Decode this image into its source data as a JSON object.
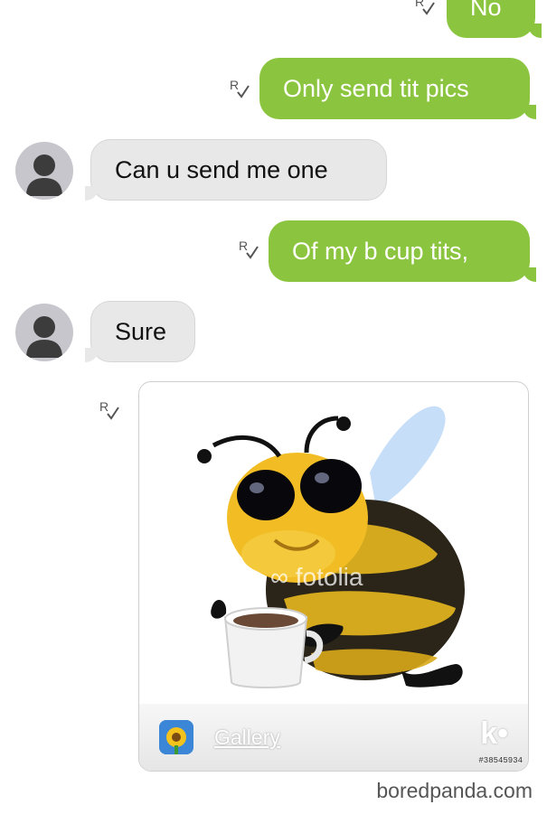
{
  "messages": [
    {
      "from": "me",
      "text": "No",
      "receipt": "R"
    },
    {
      "from": "me",
      "text": "Only send tit pics",
      "receipt": "R"
    },
    {
      "from": "them",
      "text": "Can u send me one"
    },
    {
      "from": "me",
      "text": "Of my b cup tits,",
      "receipt": "R"
    },
    {
      "from": "them",
      "text": "Sure"
    },
    {
      "from": "me",
      "type": "image",
      "receipt": "R"
    }
  ],
  "image_card": {
    "watermark": "fotolia",
    "gallery_label": "Gallery",
    "app_logo": "k•",
    "stock_id": "#38545934"
  },
  "credit": "boredpanda.com",
  "colors": {
    "outgoing_bubble": "#8bc53f",
    "incoming_bubble": "#e8e8e8",
    "avatar_bg": "#c6c6cc"
  },
  "icons": [
    "read-receipt-icon",
    "avatar-silhouette-icon",
    "gallery-app-icon",
    "bee-sticker"
  ]
}
